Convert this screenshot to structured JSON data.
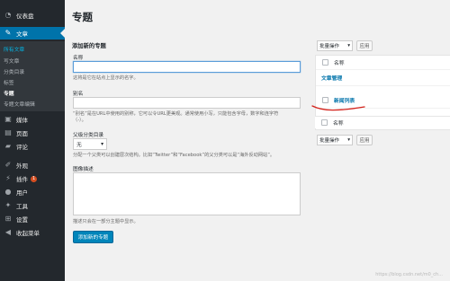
{
  "sidebar": {
    "dashboard": "仪表盘",
    "posts": "文章",
    "posts_sub": [
      "所有文章",
      "写文章",
      "分类目录",
      "标签",
      "专题",
      "专题文章编辑"
    ],
    "media": "媒体",
    "pages": "页面",
    "comments": "评论",
    "appearance": "外观",
    "plugins": "插件",
    "plugins_badge": "1",
    "users": "用户",
    "tools": "工具",
    "settings": "设置",
    "collapse": "收起菜单"
  },
  "page_title": "专题",
  "form": {
    "heading": "添加新的专题",
    "name_label": "名称",
    "name_help": "这将是它在站点上显示的名字。",
    "slug_label": "别名",
    "slug_help_1": "“别名”是在URL中使用的别称，它可以令URL更美观。通常使用小写，只能包含字母，数字和连字符",
    "slug_help_2": "（-）。",
    "parent_label": "父级分类目录",
    "parent_value": "无",
    "parent_help": "分配一个父类可以创建层次结构。比如“Twitter”和“Facebook”的父分类可以是“海外反动网站”。",
    "desc_label": "图像描述",
    "desc_help": "描述只会在一部分主题中显示。",
    "submit_label": "添加新的专题"
  },
  "list": {
    "bulk_label": "批量操作",
    "apply_label": "应用",
    "column_name": "名称",
    "rows": [
      "文章管理",
      "新闻列表"
    ]
  },
  "watermark": "https://blog.csdn.net/m0_ch..."
}
